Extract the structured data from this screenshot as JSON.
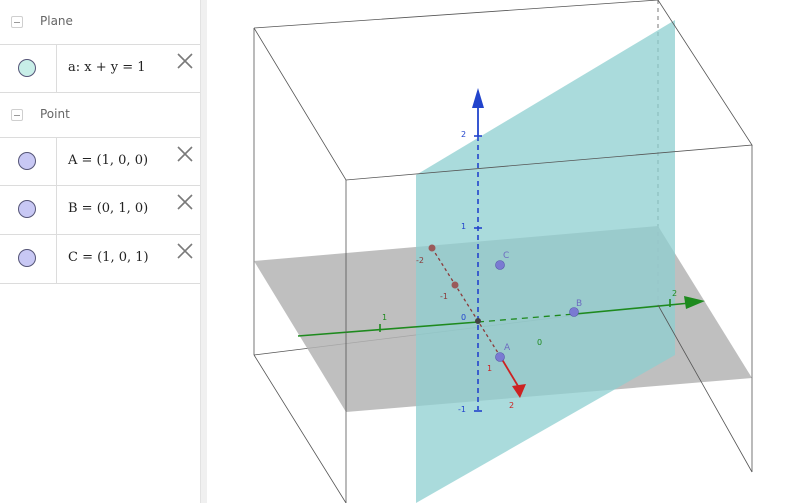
{
  "algebra": {
    "groups": [
      {
        "label": "Plane",
        "items": [
          {
            "text": "a: x + y = 1",
            "color": "#c8eee8"
          }
        ]
      },
      {
        "label": "Point",
        "items": [
          {
            "text": "A = (1, 0, 0)",
            "color": "#c8c8f4"
          },
          {
            "text": "B = (0, 1, 0)",
            "color": "#c8c8f4"
          },
          {
            "text": "C = (1, 0, 1)",
            "color": "#c8c8f4"
          }
        ]
      }
    ],
    "delete_icon": "close-icon"
  },
  "graphics": {
    "colors": {
      "plane_fill": "#8ecfd0",
      "floor_fill": "#b4b4b4",
      "x_axis": "#cc2222",
      "y_axis": "#1e8a1e",
      "z_axis": "#2244cc",
      "point": "#7a7ad2"
    },
    "x_axis_labels": [
      "-2",
      "-1",
      "1",
      "2"
    ],
    "y_axis_labels": [
      "-1",
      "0",
      "1",
      "2"
    ],
    "z_axis_labels": [
      "2",
      "1",
      "0",
      "-1"
    ],
    "point_labels": [
      "A",
      "B",
      "C"
    ]
  }
}
